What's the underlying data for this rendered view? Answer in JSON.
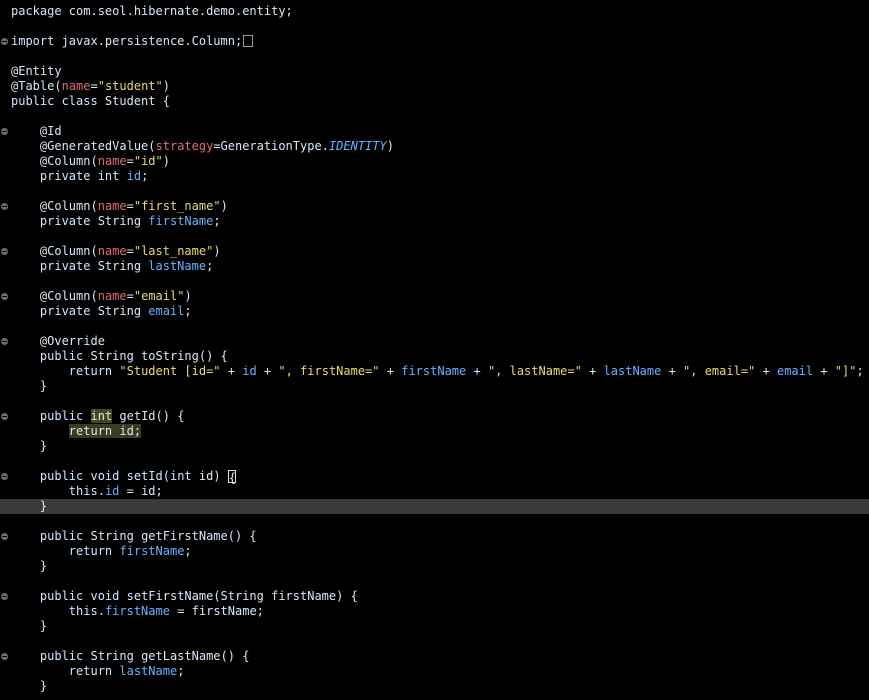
{
  "lines": [
    {
      "fold": false,
      "parts": [
        [
          "kw",
          "package"
        ],
        [
          "p",
          " com.seol.hibernate.demo.entity;"
        ]
      ]
    },
    {
      "fold": false,
      "parts": []
    },
    {
      "fold": true,
      "collapsed": true,
      "parts": [
        [
          "kw",
          "import"
        ],
        [
          "p",
          " javax.persistence.Column;"
        ]
      ]
    },
    {
      "fold": false,
      "parts": []
    },
    {
      "fold": false,
      "parts": [
        [
          "ann",
          "@Entity"
        ]
      ]
    },
    {
      "fold": false,
      "parts": [
        [
          "ann",
          "@Table"
        ],
        [
          "p",
          "("
        ],
        [
          "attr",
          "name"
        ],
        [
          "p",
          "="
        ],
        [
          "str",
          "\"student\""
        ],
        [
          "p",
          ")"
        ]
      ]
    },
    {
      "fold": false,
      "parts": [
        [
          "kw",
          "public class"
        ],
        [
          "p",
          " Student {"
        ]
      ]
    },
    {
      "fold": false,
      "parts": []
    },
    {
      "fold": true,
      "parts": [
        [
          "p",
          "    "
        ],
        [
          "ann",
          "@Id"
        ]
      ]
    },
    {
      "fold": false,
      "parts": [
        [
          "p",
          "    "
        ],
        [
          "ann",
          "@GeneratedValue"
        ],
        [
          "p",
          "("
        ],
        [
          "attr",
          "strategy"
        ],
        [
          "p",
          "=GenerationType."
        ],
        [
          "cst",
          "IDENTITY"
        ],
        [
          "p",
          ")"
        ]
      ]
    },
    {
      "fold": false,
      "parts": [
        [
          "p",
          "    "
        ],
        [
          "ann",
          "@Column"
        ],
        [
          "p",
          "("
        ],
        [
          "attr",
          "name"
        ],
        [
          "p",
          "="
        ],
        [
          "str",
          "\"id\""
        ],
        [
          "p",
          ")"
        ]
      ]
    },
    {
      "fold": false,
      "parts": [
        [
          "p",
          "    "
        ],
        [
          "kw",
          "private int"
        ],
        [
          "p",
          " "
        ],
        [
          "fld",
          "id"
        ],
        [
          "p",
          ";"
        ]
      ]
    },
    {
      "fold": false,
      "parts": []
    },
    {
      "fold": true,
      "parts": [
        [
          "p",
          "    "
        ],
        [
          "ann",
          "@Column"
        ],
        [
          "p",
          "("
        ],
        [
          "attr",
          "name"
        ],
        [
          "p",
          "="
        ],
        [
          "str",
          "\"first_name\""
        ],
        [
          "p",
          ")"
        ]
      ]
    },
    {
      "fold": false,
      "parts": [
        [
          "p",
          "    "
        ],
        [
          "kw",
          "private"
        ],
        [
          "p",
          " String "
        ],
        [
          "fld",
          "firstName"
        ],
        [
          "p",
          ";"
        ]
      ]
    },
    {
      "fold": false,
      "parts": []
    },
    {
      "fold": true,
      "parts": [
        [
          "p",
          "    "
        ],
        [
          "ann",
          "@Column"
        ],
        [
          "p",
          "("
        ],
        [
          "attr",
          "name"
        ],
        [
          "p",
          "="
        ],
        [
          "str",
          "\"last_name\""
        ],
        [
          "p",
          ")"
        ]
      ]
    },
    {
      "fold": false,
      "parts": [
        [
          "p",
          "    "
        ],
        [
          "kw",
          "private"
        ],
        [
          "p",
          " String "
        ],
        [
          "fld",
          "lastName"
        ],
        [
          "p",
          ";"
        ]
      ]
    },
    {
      "fold": false,
      "parts": []
    },
    {
      "fold": true,
      "parts": [
        [
          "p",
          "    "
        ],
        [
          "ann",
          "@Column"
        ],
        [
          "p",
          "("
        ],
        [
          "attr",
          "name"
        ],
        [
          "p",
          "="
        ],
        [
          "str",
          "\"email\""
        ],
        [
          "p",
          ")"
        ]
      ]
    },
    {
      "fold": false,
      "parts": [
        [
          "p",
          "    "
        ],
        [
          "kw",
          "private"
        ],
        [
          "p",
          " String "
        ],
        [
          "fld",
          "email"
        ],
        [
          "p",
          ";"
        ]
      ]
    },
    {
      "fold": false,
      "parts": []
    },
    {
      "fold": true,
      "parts": [
        [
          "p",
          "    "
        ],
        [
          "ann",
          "@Override"
        ]
      ]
    },
    {
      "fold": false,
      "parts": [
        [
          "p",
          "    "
        ],
        [
          "kw",
          "public"
        ],
        [
          "p",
          " String toString() {"
        ]
      ]
    },
    {
      "fold": false,
      "parts": [
        [
          "p",
          "        "
        ],
        [
          "kw",
          "return"
        ],
        [
          "p",
          " "
        ],
        [
          "str",
          "\"Student [id=\""
        ],
        [
          "p",
          " + "
        ],
        [
          "fld",
          "id"
        ],
        [
          "p",
          " + "
        ],
        [
          "str",
          "\", firstName=\""
        ],
        [
          "p",
          " + "
        ],
        [
          "fld",
          "firstName"
        ],
        [
          "p",
          " + "
        ],
        [
          "str",
          "\", lastName=\""
        ],
        [
          "p",
          " + "
        ],
        [
          "fld",
          "lastName"
        ],
        [
          "p",
          " + "
        ],
        [
          "str",
          "\", email=\""
        ],
        [
          "p",
          " + "
        ],
        [
          "fld",
          "email"
        ],
        [
          "p",
          " + "
        ],
        [
          "str",
          "\"]\""
        ],
        [
          "p",
          ";"
        ]
      ]
    },
    {
      "fold": false,
      "parts": [
        [
          "p",
          "    }"
        ]
      ]
    },
    {
      "fold": false,
      "parts": []
    },
    {
      "fold": true,
      "parts": [
        [
          "p",
          "    "
        ],
        [
          "kw",
          "public"
        ],
        [
          "p",
          " "
        ],
        [
          "hl",
          "int"
        ],
        [
          "p",
          " getId() {"
        ]
      ]
    },
    {
      "fold": false,
      "parts": [
        [
          "p",
          "        "
        ],
        [
          "hl2",
          "return id;"
        ]
      ]
    },
    {
      "fold": false,
      "parts": [
        [
          "p",
          "    }"
        ]
      ]
    },
    {
      "fold": false,
      "parts": []
    },
    {
      "fold": true,
      "parts": [
        [
          "p",
          "    "
        ],
        [
          "kw",
          "public void"
        ],
        [
          "p",
          " setId("
        ],
        [
          "kw",
          "int"
        ],
        [
          "p",
          " id) "
        ],
        [
          "caret",
          "{"
        ]
      ]
    },
    {
      "fold": false,
      "parts": [
        [
          "p",
          "        "
        ],
        [
          "kw",
          "this"
        ],
        [
          "p",
          "."
        ],
        [
          "fld",
          "id"
        ],
        [
          "p",
          " = id;"
        ]
      ]
    },
    {
      "fold": false,
      "current": true,
      "parts": [
        [
          "p",
          "    }"
        ]
      ]
    },
    {
      "fold": false,
      "parts": []
    },
    {
      "fold": true,
      "parts": [
        [
          "p",
          "    "
        ],
        [
          "kw",
          "public"
        ],
        [
          "p",
          " String getFirstName() {"
        ]
      ]
    },
    {
      "fold": false,
      "parts": [
        [
          "p",
          "        "
        ],
        [
          "kw",
          "return"
        ],
        [
          "p",
          " "
        ],
        [
          "fld",
          "firstName"
        ],
        [
          "p",
          ";"
        ]
      ]
    },
    {
      "fold": false,
      "parts": [
        [
          "p",
          "    }"
        ]
      ]
    },
    {
      "fold": false,
      "parts": []
    },
    {
      "fold": true,
      "parts": [
        [
          "p",
          "    "
        ],
        [
          "kw",
          "public void"
        ],
        [
          "p",
          " setFirstName(String firstName) {"
        ]
      ]
    },
    {
      "fold": false,
      "parts": [
        [
          "p",
          "        "
        ],
        [
          "kw",
          "this"
        ],
        [
          "p",
          "."
        ],
        [
          "fld",
          "firstName"
        ],
        [
          "p",
          " = firstName;"
        ]
      ]
    },
    {
      "fold": false,
      "parts": [
        [
          "p",
          "    }"
        ]
      ]
    },
    {
      "fold": false,
      "parts": []
    },
    {
      "fold": true,
      "parts": [
        [
          "p",
          "    "
        ],
        [
          "kw",
          "public"
        ],
        [
          "p",
          " String getLastName() {"
        ]
      ]
    },
    {
      "fold": false,
      "parts": [
        [
          "p",
          "        "
        ],
        [
          "kw",
          "return"
        ],
        [
          "p",
          " "
        ],
        [
          "fld",
          "lastName"
        ],
        [
          "p",
          ";"
        ]
      ]
    },
    {
      "fold": false,
      "parts": [
        [
          "p",
          "    }"
        ]
      ]
    }
  ]
}
